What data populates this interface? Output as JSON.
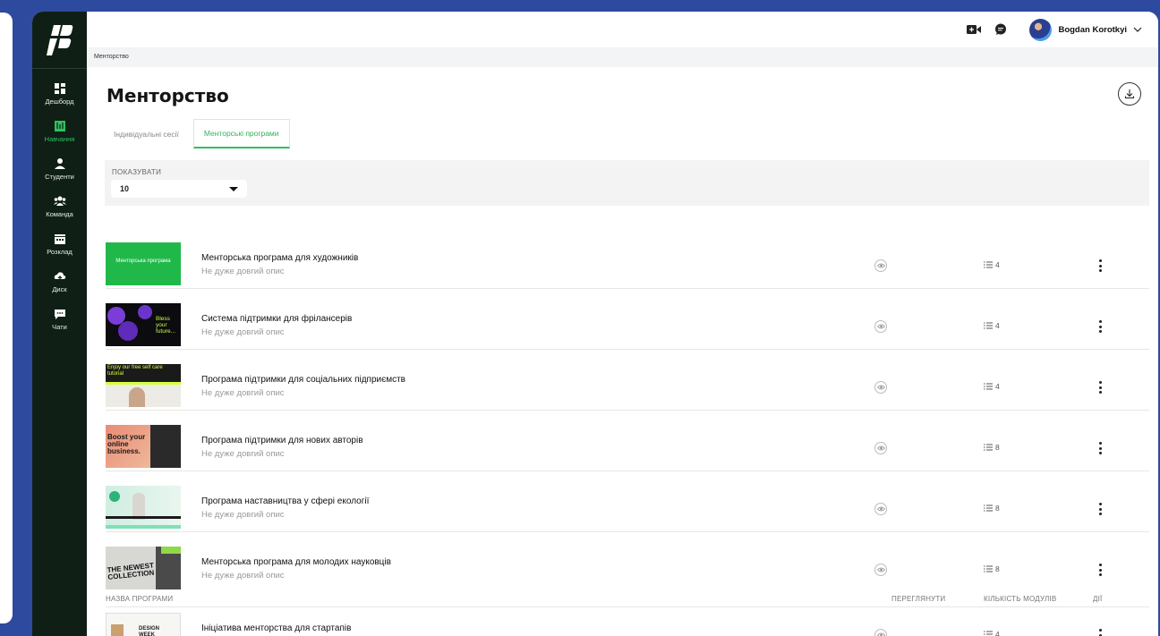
{
  "user": {
    "name": "Bogdan Korotkyi"
  },
  "sidebar": {
    "items": [
      {
        "label": "Дешборд",
        "icon": "dashboard-icon"
      },
      {
        "label": "Навчання",
        "icon": "book-icon",
        "active": true
      },
      {
        "label": "Студенти",
        "icon": "student-icon"
      },
      {
        "label": "Команда",
        "icon": "team-icon"
      },
      {
        "label": "Розклад",
        "icon": "calendar-icon"
      },
      {
        "label": "Диск",
        "icon": "cloud-icon"
      },
      {
        "label": "Чати",
        "icon": "chat-icon"
      }
    ]
  },
  "breadcrumb": "Менторство",
  "page": {
    "title": "Менторство"
  },
  "tabs": [
    {
      "label": "Індивідуальні сесії"
    },
    {
      "label": "Менторські програми",
      "active": true
    }
  ],
  "filter": {
    "label": "ПОКАЗУВАТИ",
    "value": "10"
  },
  "programs": [
    {
      "title": "Менторська програма для художників",
      "desc": "Не дуже довгий опис",
      "modules": "4",
      "thumb_text": "Менторська програма"
    },
    {
      "title": "Система підтримки для фрілансерів",
      "desc": "Не дуже довгий опис",
      "modules": "4",
      "thumb_text": "Bless your future..."
    },
    {
      "title": "Програма підтримки для соціальних підприємств",
      "desc": "Не дуже довгий опис",
      "modules": "4",
      "thumb_text": "Enjoy our free self care tutorial"
    },
    {
      "title": "Програма підтримки для нових авторів",
      "desc": "Не дуже довгий опис",
      "modules": "8",
      "thumb_text": "Boost your online business."
    },
    {
      "title": "Програма наставництва у сфері екології",
      "desc": "Не дуже довгий опис",
      "modules": "8",
      "thumb_text": ""
    },
    {
      "title": "Менторська програма для молодих науковців",
      "desc": "Не дуже довгий опис",
      "modules": "8",
      "thumb_text": "THE NEWEST COLLECTION"
    }
  ],
  "table_header": {
    "name": "НАЗВА ПРОГРАМИ",
    "view": "ПЕРЕГЛЯНУТИ",
    "modules": "КІЛЬКІСТЬ МОДУЛІВ",
    "actions": "ДІЇ"
  },
  "last_program": {
    "title": "Ініціатива менторства для стартапів",
    "modules": "4",
    "thumb_text": "DESIGN WEEK"
  },
  "colors": {
    "accent": "#2fc15e",
    "sidebar": "#0f1f16",
    "background": "#2d4a9e"
  }
}
